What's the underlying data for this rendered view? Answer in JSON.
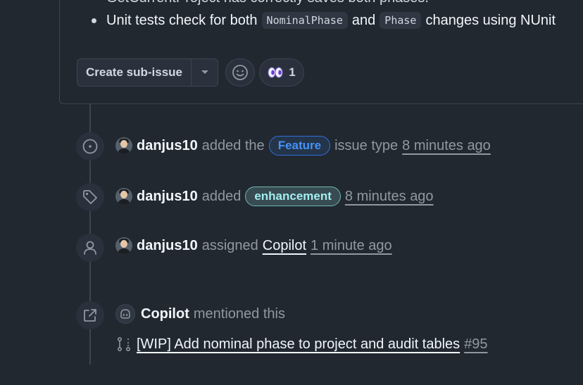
{
  "issue_body": {
    "cut_line": "GetCurrentProject has correctly saves both phases.",
    "bullet": {
      "prefix": "Unit tests check for both",
      "code1": "NominalPhase",
      "middle": "and",
      "code2": "Phase",
      "suffix": "changes using NUnit"
    }
  },
  "actions": {
    "create_sub_issue_label": "Create sub-issue",
    "reaction_count": "1"
  },
  "timeline": [
    {
      "icon": "issue-type-icon",
      "user": "danjus10",
      "verb": "added the",
      "label": "Feature",
      "after": "issue type",
      "time": "8 minutes ago"
    },
    {
      "icon": "tag-icon",
      "user": "danjus10",
      "verb": "added",
      "label": "enhancement",
      "time": "8 minutes ago"
    },
    {
      "icon": "person-icon",
      "user": "danjus10",
      "verb": "assigned",
      "assignee": "Copilot",
      "time": "1 minute ago"
    },
    {
      "icon": "cross-reference-icon",
      "user": "Copilot",
      "verb": "mentioned this",
      "pr_title": "[WIP] Add nominal phase to project and audit tables",
      "pr_number": "#95"
    }
  ],
  "colors": {
    "background": "#212830",
    "feature_label": "#4493f8",
    "enhancement_label": "#a2eeef",
    "border": "#3d4451"
  }
}
